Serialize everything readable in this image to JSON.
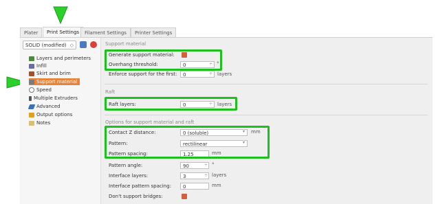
{
  "tabs": [
    "Plater",
    "Print Settings",
    "Filament Settings",
    "Printer Settings"
  ],
  "preset": {
    "value": "SOLID (modified)",
    "arrow": "◇"
  },
  "nav": {
    "items": [
      {
        "label": "Layers and perimeters",
        "icon": "layers-icon",
        "color": "#4a8a3a"
      },
      {
        "label": "Infill",
        "icon": "infill-icon",
        "color": "#6a6aa8"
      },
      {
        "label": "Skirt and brim",
        "icon": "skirt-icon",
        "color": "#a0522d"
      },
      {
        "label": "Support material",
        "icon": "support-icon",
        "color": "#7b7b7b"
      },
      {
        "label": "Speed",
        "icon": "speed-icon",
        "color": "#777777"
      },
      {
        "label": "Multiple Extruders",
        "icon": "extruders-icon",
        "color": "#555555"
      },
      {
        "label": "Advanced",
        "icon": "wrench-icon",
        "color": "#3b6fb6"
      },
      {
        "label": "Output options",
        "icon": "output-icon",
        "color": "#e0a020"
      },
      {
        "label": "Notes",
        "icon": "notes-icon",
        "color": "#d8c070"
      }
    ]
  },
  "support": {
    "title": "Support material",
    "generate_label": "Generate support material:",
    "overhang_label": "Overhang threshold:",
    "overhang_value": "0",
    "overhang_unit": "°",
    "enforce_label": "Enforce support for the first:",
    "enforce_value": "0",
    "enforce_unit": "layers"
  },
  "raft": {
    "title": "Raft",
    "layers_label": "Raft layers:",
    "layers_value": "0",
    "layers_unit": "layers"
  },
  "options": {
    "title": "Options for support material and raft",
    "contact_label": "Contact Z distance:",
    "contact_value": "0 (soluble)",
    "contact_unit": "mm",
    "pattern_label": "Pattern:",
    "pattern_value": "rectilinear",
    "spacing_label": "Pattern spacing:",
    "spacing_value": "1.25",
    "spacing_unit": "mm",
    "angle_label": "Pattern angle:",
    "angle_value": "90",
    "angle_unit": "°",
    "iface_layers_label": "Interface layers:",
    "iface_layers_value": "3",
    "iface_layers_unit": "layers",
    "iface_spacing_label": "Interface pattern spacing:",
    "iface_spacing_value": "0",
    "iface_spacing_unit": "mm",
    "bridges_label": "Don't support bridges:"
  },
  "spinner_glyph": "÷",
  "dropdown_glyph": "▾",
  "colors": {
    "highlight": "#1fbf1f",
    "selected": "#e8833a",
    "checkbox": "#d2603a"
  }
}
